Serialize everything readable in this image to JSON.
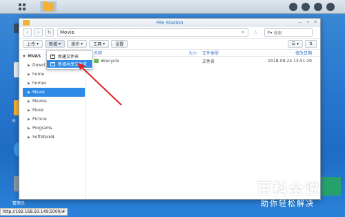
{
  "window": {
    "title": "File Station"
  },
  "navbar": {
    "path": "Movie",
    "search_placeholder": "搜索"
  },
  "toolbar": {
    "upload": "上传",
    "new": "新增",
    "action": "操作",
    "tools": "工具",
    "settings": "设置"
  },
  "dropdown": {
    "items": [
      "新建文件夹",
      "新增共享文件夹"
    ]
  },
  "sidebar": {
    "root": "MVAS",
    "items": [
      "Downl…",
      "home",
      "homes",
      "Movie",
      "Movies",
      "Music",
      "Picture",
      "Programs",
      "SoftWareN"
    ]
  },
  "list": {
    "headers": {
      "name": "名称",
      "size": "大小",
      "type": "文件类型",
      "date": "修改日期"
    },
    "rows": [
      {
        "name": "#recycle",
        "size": "",
        "type": "文件夹",
        "date": "2018-09-24 13:51:29"
      }
    ]
  },
  "desktop": {
    "labels": [
      "Fi",
      "管理员"
    ]
  },
  "status": {
    "url": "http://192.168.50.149:5000/#"
  },
  "watermark": {
    "title": "百科全说",
    "subtitle": "助你轻松解决"
  },
  "colors": {
    "accent": "#2d8ae5",
    "annotation": "#e02020",
    "folder": "#f2b233"
  }
}
